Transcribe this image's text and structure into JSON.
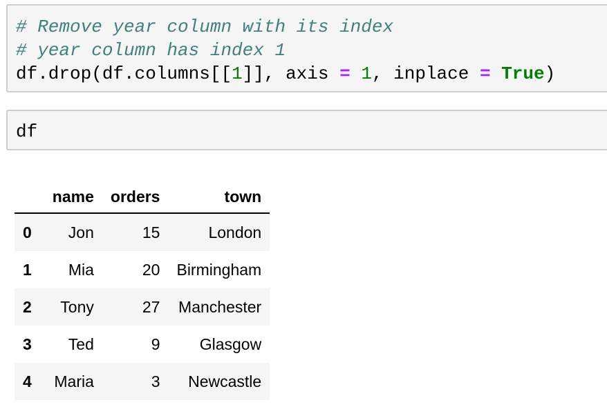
{
  "cells": [
    {
      "type": "code",
      "lines": [
        {
          "comment": "# Remove year column with its index"
        },
        {
          "comment": "# year column has index 1"
        },
        {
          "p1": "df.drop(df.columns[[",
          "n1": "1",
          "p2": "]], axis ",
          "op1": "=",
          "p3": " ",
          "n2": "1",
          "p4": ", inplace ",
          "op2": "=",
          "p5": " ",
          "kw": "True",
          "p6": ")"
        }
      ]
    },
    {
      "type": "code",
      "lines": [
        {
          "text": "df"
        }
      ]
    }
  ],
  "output_table": {
    "columns": [
      "",
      "name",
      "orders",
      "town"
    ],
    "rows": [
      {
        "index": "0",
        "name": "Jon",
        "orders": "15",
        "town": "London"
      },
      {
        "index": "1",
        "name": "Mia",
        "orders": "20",
        "town": "Birmingham"
      },
      {
        "index": "2",
        "name": "Tony",
        "orders": "27",
        "town": "Manchester"
      },
      {
        "index": "3",
        "name": "Ted",
        "orders": "9",
        "town": "Glasgow"
      },
      {
        "index": "4",
        "name": "Maria",
        "orders": "3",
        "town": "Newcastle"
      }
    ]
  }
}
